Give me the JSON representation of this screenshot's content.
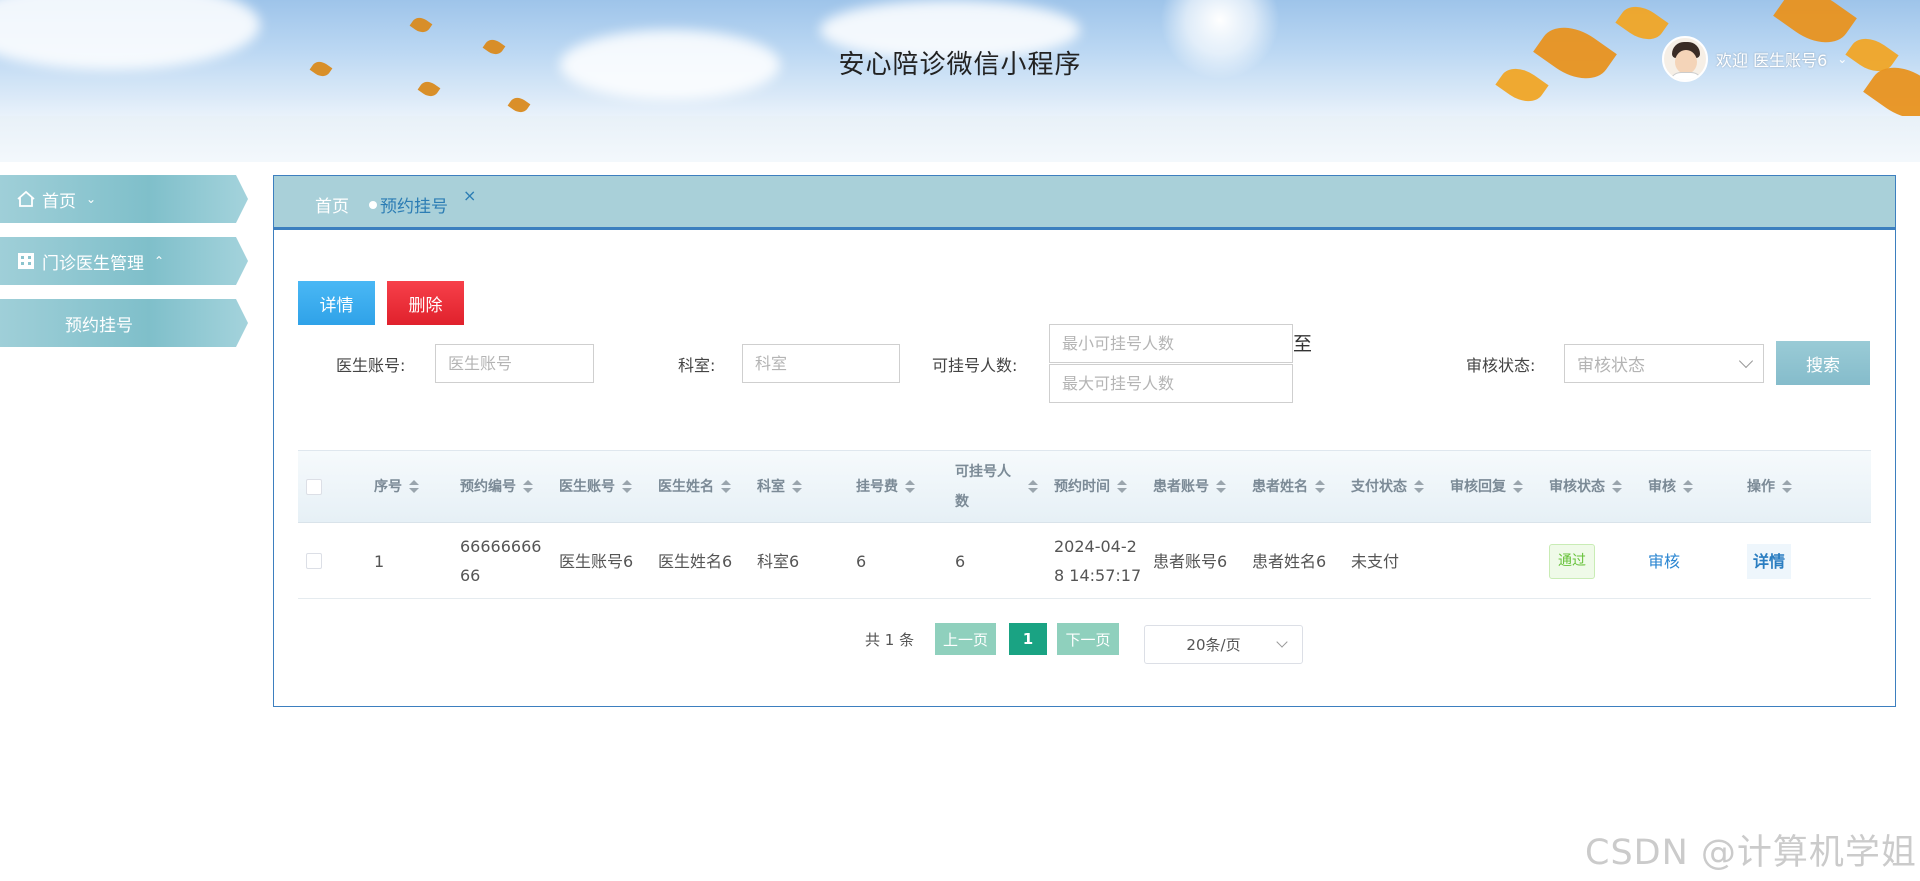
{
  "header": {
    "title": "安心陪诊微信小程序",
    "welcome": "欢迎 医生账号6",
    "user_caret": "⌄"
  },
  "sidebar": {
    "items": [
      {
        "label": "首页",
        "icon": "home-icon",
        "caret": "⌄"
      },
      {
        "label": "门诊医生管理",
        "icon": "grid-building-icon",
        "caret": "⌃"
      },
      {
        "label": "预约挂号"
      }
    ]
  },
  "tabs": {
    "home": "首页",
    "active": "预约挂号",
    "close": "×"
  },
  "toolbar": {
    "detail_label": "详情",
    "delete_label": "删除",
    "search_label": "搜索"
  },
  "filters": {
    "doctor_account_label": "医生账号:",
    "doctor_account_placeholder": "医生账号",
    "dept_label": "科室:",
    "dept_placeholder": "科室",
    "count_label": "可挂号人数:",
    "min_placeholder": "最小可挂号人数",
    "to_label": "至",
    "max_placeholder": "最大可挂号人数",
    "audit_label": "审核状态:",
    "audit_placeholder": "审核状态"
  },
  "table": {
    "headers": [
      "序号",
      "预约编号",
      "医生账号",
      "医生姓名",
      "科室",
      "挂号费",
      "可挂号人数",
      "预约时间",
      "患者账号",
      "患者姓名",
      "支付状态",
      "审核回复",
      "审核状态",
      "审核",
      "操作"
    ],
    "rows": [
      {
        "index": "1",
        "booking_no": "6666666666",
        "doctor_account": "医生账号6",
        "doctor_name": "医生姓名6",
        "dept": "科室6",
        "fee": "6",
        "available": "6",
        "time": "2024-04-28 14:57:17",
        "patient_account": "患者账号6",
        "patient_name": "患者姓名6",
        "pay_status": "未支付",
        "audit_reply": "",
        "audit_status": "通过",
        "audit_action": "审核",
        "op": "详情"
      }
    ]
  },
  "pagination": {
    "total": "共 1 条",
    "prev": "上一页",
    "page": "1",
    "next": "下一页",
    "page_size": "20条/页"
  },
  "watermark": "CSDN @计算机学姐",
  "colors": {
    "accent_teal": "#1aa383",
    "panel_border": "#3d7fbf",
    "tab_bar": "#a9d0d9",
    "btn_blue": "#2fa2e8",
    "btn_red": "#e0212c"
  }
}
